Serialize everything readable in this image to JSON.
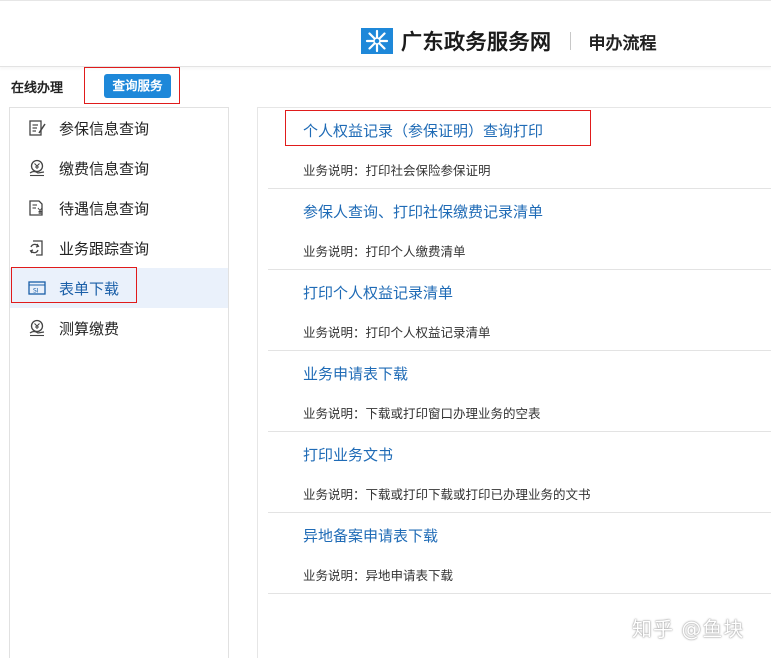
{
  "header": {
    "site_name": "广东政务服务网",
    "section_title": "申办流程",
    "logo_color": "#1e88d9"
  },
  "tabs": {
    "online": "在线办理",
    "query": "查询服务",
    "query_color": "#1e88d9"
  },
  "sidebar": {
    "items": [
      {
        "label": "参保信息查询",
        "icon": "edit-document-icon"
      },
      {
        "label": "缴费信息查询",
        "icon": "payment-icon"
      },
      {
        "label": "待遇信息查询",
        "icon": "yuan-document-icon"
      },
      {
        "label": "业务跟踪查询",
        "icon": "refresh-document-icon"
      },
      {
        "label": "表单下载",
        "icon": "si-form-icon",
        "active": true
      },
      {
        "label": "测算缴费",
        "icon": "calculate-icon"
      }
    ]
  },
  "content": {
    "items": [
      {
        "title": "个人权益记录（参保证明）查询打印",
        "desc": "业务说明：打印社会保险参保证明"
      },
      {
        "title": "参保人查询、打印社保缴费记录清单",
        "desc": "业务说明：打印个人缴费清单"
      },
      {
        "title": "打印个人权益记录清单",
        "desc": "业务说明：打印个人权益记录清单"
      },
      {
        "title": "业务申请表下载",
        "desc": "业务说明：下载或打印窗口办理业务的空表"
      },
      {
        "title": "打印业务文书",
        "desc": "业务说明：下载或打印下载或打印已办理业务的文书"
      },
      {
        "title": "异地备案申请表下载",
        "desc": "业务说明：异地申请表下载"
      }
    ]
  },
  "watermark": "知乎 @鱼块",
  "colors": {
    "link": "#1f6bb6",
    "highlight_border": "#e01b1b",
    "active_bg": "#eaf1fb"
  }
}
